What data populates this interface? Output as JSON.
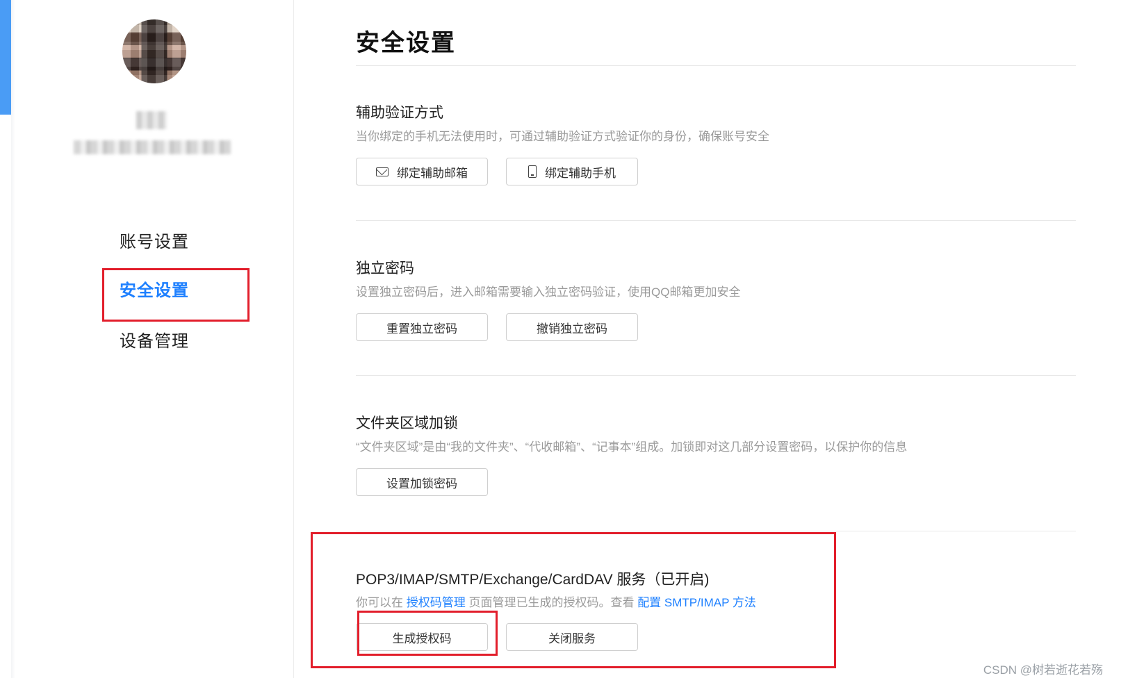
{
  "sidebar": {
    "nav": [
      {
        "label": "账号设置"
      },
      {
        "label": "安全设置"
      },
      {
        "label": "设备管理"
      }
    ]
  },
  "main": {
    "title": "安全设置",
    "sections": [
      {
        "title": "辅助验证方式",
        "description": "当你绑定的手机无法使用时，可通过辅助验证方式验证你的身份，确保账号安全",
        "buttons": [
          "绑定辅助邮箱",
          "绑定辅助手机"
        ],
        "button_icons": [
          "mail-icon",
          "phone-icon"
        ]
      },
      {
        "title": "独立密码",
        "description": "设置独立密码后，进入邮箱需要输入独立密码验证，使用QQ邮箱更加安全",
        "buttons": [
          "重置独立密码",
          "撤销独立密码"
        ]
      },
      {
        "title": "文件夹区域加锁",
        "description": "“文件夹区域”是由“我的文件夹”、“代收邮箱”、“记事本”组成。加锁即对这几部分设置密码，以保护你的信息",
        "buttons": [
          "设置加锁密码"
        ]
      },
      {
        "title": "POP3/IMAP/SMTP/Exchange/CardDAV 服务（已开启)",
        "description_parts": {
          "pre": "你可以在 ",
          "link1": "授权码管理",
          "mid": " 页面管理已生成的授权码。查看 ",
          "link2": "配置 SMTP/IMAP 方法"
        },
        "buttons": [
          "生成授权码",
          "关闭服务"
        ]
      }
    ]
  },
  "watermark": "CSDN @树若逝花若殇",
  "colors": {
    "accent": "#1e80ff",
    "highlight_box": "#e21e2b",
    "accent_strip": "#4a9cf5"
  }
}
